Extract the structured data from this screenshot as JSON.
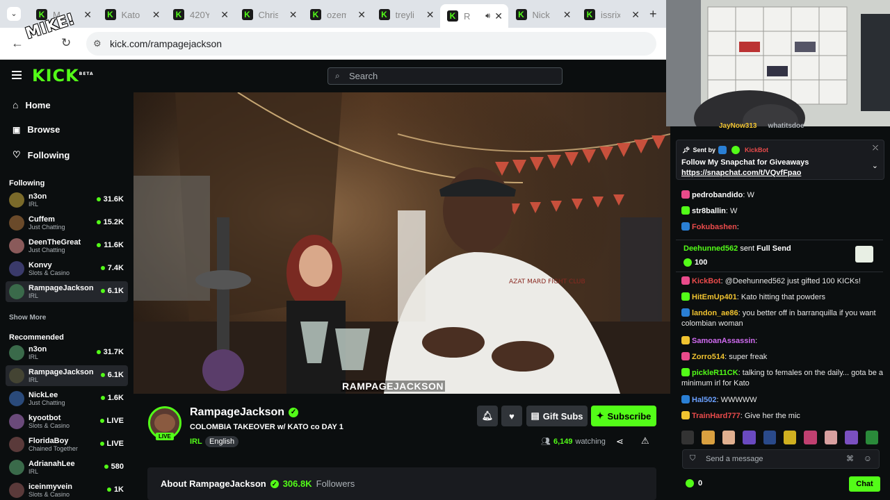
{
  "browser": {
    "tabs": [
      {
        "label": "M"
      },
      {
        "label": "Kato"
      },
      {
        "label": "420Y"
      },
      {
        "label": "Chris"
      },
      {
        "label": "ozem"
      },
      {
        "label": "treyli"
      },
      {
        "label": "R"
      },
      {
        "label": "Nick"
      },
      {
        "label": "issrix"
      }
    ],
    "active_tab": 6,
    "url": "kick.com/rampagejackson"
  },
  "header": {
    "logo": "KICK",
    "logo_badge": "BETA",
    "search_placeholder": "Search"
  },
  "nav": {
    "home": "Home",
    "browse": "Browse",
    "following": "Following"
  },
  "sidebar": {
    "following_title": "Following",
    "following": [
      {
        "name": "n3on",
        "category": "IRL",
        "viewers": "31.6K"
      },
      {
        "name": "Cuffem",
        "category": "Just Chatting",
        "viewers": "15.2K"
      },
      {
        "name": "DeenTheGreat",
        "category": "Just Chatting",
        "viewers": "11.6K"
      },
      {
        "name": "Konvy",
        "category": "Slots & Casino",
        "viewers": "7.4K"
      },
      {
        "name": "RampageJackson",
        "category": "IRL",
        "viewers": "6.1K"
      }
    ],
    "show_more": "Show More",
    "recommended_title": "Recommended",
    "recommended": [
      {
        "name": "n3on",
        "category": "IRL",
        "viewers": "31.7K"
      },
      {
        "name": "RampageJackson",
        "category": "IRL",
        "viewers": "6.1K"
      },
      {
        "name": "NickLee",
        "category": "Just Chatting",
        "viewers": "1.6K"
      },
      {
        "name": "kyootbot",
        "category": "Slots & Casino",
        "viewers": "LIVE"
      },
      {
        "name": "FloridaBoy",
        "category": "Chained Together",
        "viewers": "LIVE"
      },
      {
        "name": "AdrianahLee",
        "category": "IRL",
        "viewers": "580"
      },
      {
        "name": "iceinmyvein",
        "category": "Slots & Casino",
        "viewers": "1K"
      }
    ]
  },
  "stream": {
    "caption": "RAMPAGEJACKSON",
    "shirt_text": "AZAT MARD FIGHT CLUB",
    "live_badge": "LIVE",
    "streamer": "RampageJackson",
    "title": "COLOMBIA TAKEOVER w/ KATO co  DAY 1",
    "category": "IRL",
    "language": "English",
    "gift_subs": "Gift Subs",
    "subscribe": "Subscribe",
    "watching_count": "6,149",
    "watching_label": "watching",
    "about_label": "About RampageJackson",
    "followers_count": "306.8K",
    "followers_label": "Followers"
  },
  "cam": {
    "overlay_text": "MIKE!"
  },
  "chat": {
    "top_users": [
      "JayNow313",
      "whatitsdoe"
    ],
    "pinned": {
      "sent_by": "Sent by",
      "sender": "KickBot",
      "text": "Follow My Snapchat for Giveaways",
      "link": "https://snapchat.com/t/VQvfFpao"
    },
    "messages": [
      {
        "user": "pedrobandido",
        "text": "W",
        "color": "#ffffff"
      },
      {
        "user": "str8ballin",
        "text": "W",
        "color": "#ffffff"
      },
      {
        "user": "Fokubashen",
        "text": "",
        "color": "#e94b4b"
      }
    ],
    "gift": {
      "user": "Deehunned562",
      "mid": "sent",
      "item": "Full Send",
      "amount": "100"
    },
    "messages2": [
      {
        "user": "KickBot",
        "text": "@Deehunned562 just gifted 100 KICKs!",
        "color": "#e94b4b"
      },
      {
        "user": "HitEmUp401",
        "text": "Kato hitting that powders",
        "color": "#f0c330"
      },
      {
        "user": "landon_ae86",
        "text": "you better off in barranquilla if you want colombian woman",
        "color": "#f0c330"
      },
      {
        "user": "SamoanAssassin",
        "text": "",
        "color": "#d06bf0"
      },
      {
        "user": "Zorro514",
        "text": "super freak",
        "color": "#f0c330"
      },
      {
        "user": "pickleR11CK",
        "text": "talking to females on the daily... gota be a minimum irl for Kato",
        "color": "#53fc18"
      },
      {
        "user": "Hal502",
        "text": "WWWWW",
        "color": "#6aa0ff"
      },
      {
        "user": "TrainHard777",
        "text": "Give her the mic",
        "color": "#e94b4b"
      }
    ],
    "input_placeholder": "Send a message",
    "kicks_count": "0",
    "chat_button": "Chat"
  }
}
